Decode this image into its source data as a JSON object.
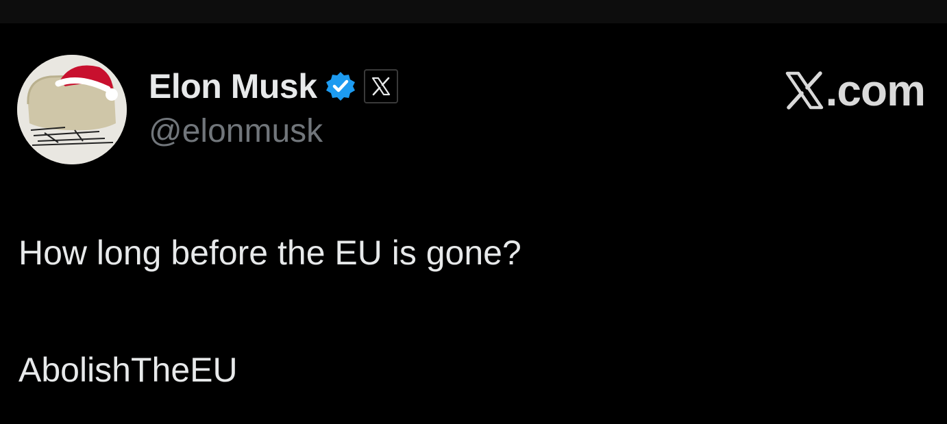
{
  "author": {
    "display_name": "Elon Musk",
    "handle": "@elonmusk",
    "verified": true,
    "verified_color": "#1d9bf0",
    "affiliate_icon": "x-logo-icon"
  },
  "watermark": {
    "brand_icon": "x-logo-icon",
    "suffix": ".com"
  },
  "tweet": {
    "text": "How long before the EU is gone?",
    "hashtag": "AbolishTheEU"
  },
  "colors": {
    "background": "#000000",
    "primary_text": "#e7e9ea",
    "secondary_text": "#71767b"
  }
}
